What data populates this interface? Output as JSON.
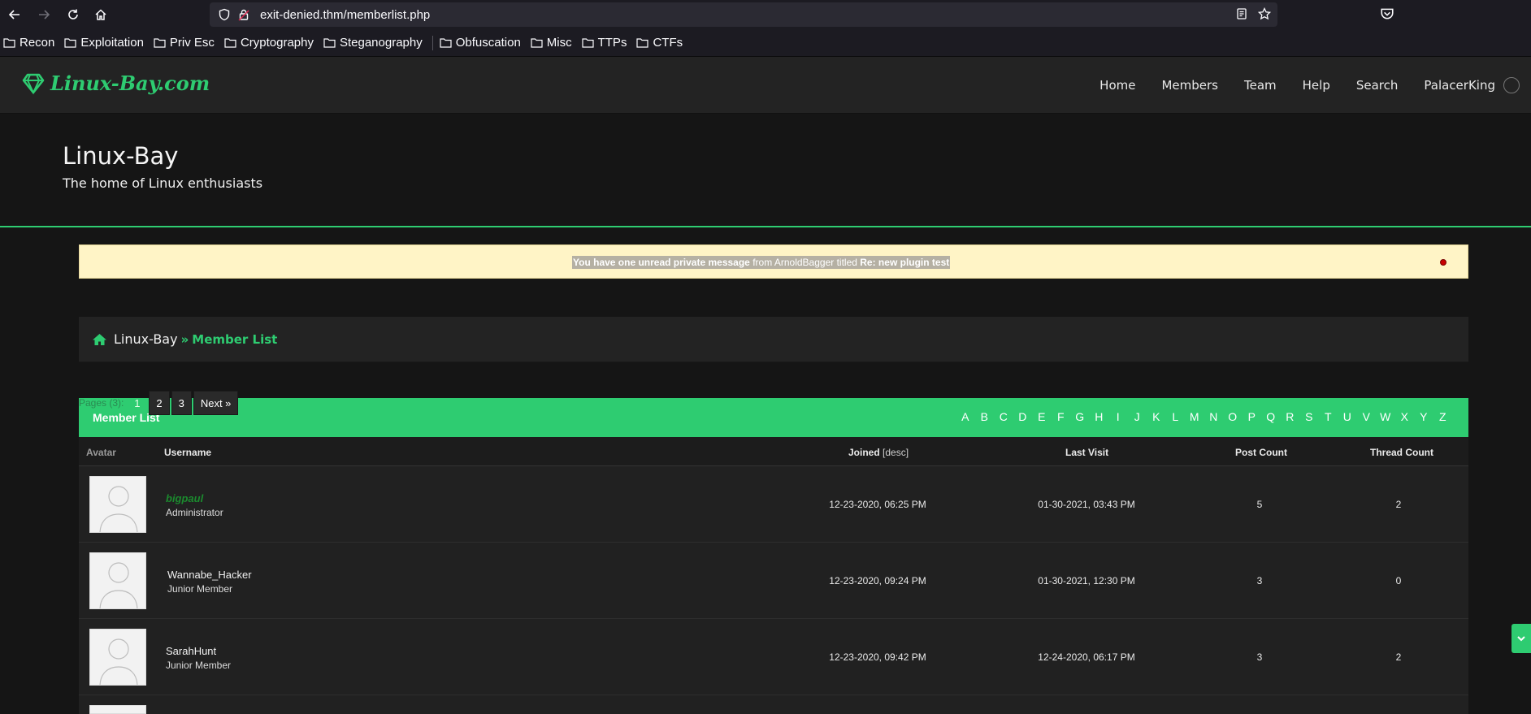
{
  "browser": {
    "url": "exit-denied.thm/memberlist.php",
    "bookmarks": [
      "Recon",
      "Exploitation",
      "Priv Esc",
      "Cryptography",
      "Steganography",
      "Obfuscation",
      "Misc",
      "TTPs",
      "CTFs"
    ]
  },
  "site": {
    "logo_text": "Linux-Bay.com",
    "nav": [
      "Home",
      "Members",
      "Team",
      "Help",
      "Search"
    ],
    "username": "PalacerKing",
    "title": "Linux-Bay",
    "tagline": "The home of Linux enthusiasts"
  },
  "pm_alert": {
    "part1": "You have one unread private message",
    "part2": " from ArnoldBagger titled ",
    "part3": "Re: new plugin test"
  },
  "breadcrumb": {
    "home": "Linux-Bay",
    "separator": "»",
    "current": "Member List"
  },
  "pagination": {
    "label": "Pages (3):",
    "pages": [
      "1",
      "2",
      "3"
    ],
    "next": "Next »"
  },
  "member_list": {
    "title": "Member List",
    "letters": [
      "A",
      "B",
      "C",
      "D",
      "E",
      "F",
      "G",
      "H",
      "I",
      "J",
      "K",
      "L",
      "M",
      "N",
      "O",
      "P",
      "Q",
      "R",
      "S",
      "T",
      "U",
      "V",
      "W",
      "X",
      "Y",
      "Z"
    ],
    "columns": {
      "avatar": "Avatar",
      "username": "Username",
      "joined": "Joined",
      "joined_sort": "[desc]",
      "last_visit": "Last Visit",
      "post_count": "Post Count",
      "thread_count": "Thread Count"
    },
    "rows": [
      {
        "username": "bigpaul",
        "role": "Administrator",
        "joined": "12-23-2020, 06:25 PM",
        "last_visit": "01-30-2021, 03:43 PM",
        "posts": "5",
        "threads": "2"
      },
      {
        "username": "Wannabe_Hacker",
        "role": "Junior Member",
        "joined": "12-23-2020, 09:24 PM",
        "last_visit": "01-30-2021, 12:30 PM",
        "posts": "3",
        "threads": "0"
      },
      {
        "username": "SarahHunt",
        "role": "Junior Member",
        "joined": "12-23-2020, 09:42 PM",
        "last_visit": "12-24-2020, 06:17 PM",
        "posts": "3",
        "threads": "2"
      }
    ]
  },
  "colors": {
    "accent": "#2ecc71",
    "admin_name": "#1b8a2e",
    "alert_bg": "#fff4c6"
  }
}
